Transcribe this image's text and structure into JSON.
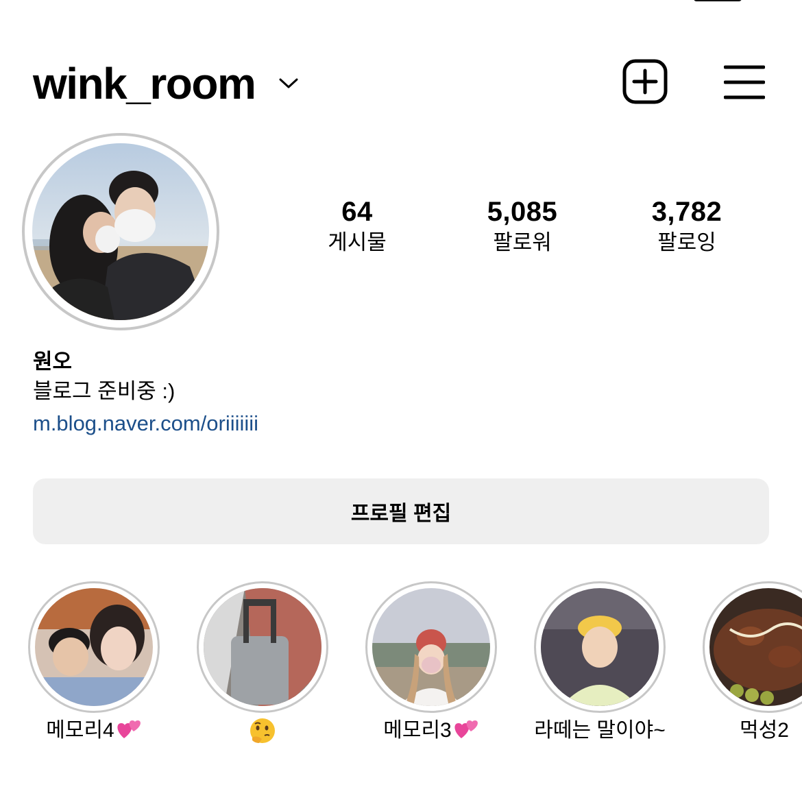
{
  "header": {
    "username": "wink_room",
    "add_icon": "plus-square-icon",
    "menu_icon": "hamburger-menu-icon"
  },
  "stats": [
    {
      "count": "64",
      "label": "게시물"
    },
    {
      "count": "5,085",
      "label": "팔로워"
    },
    {
      "count": "3,782",
      "label": "팔로잉"
    }
  ],
  "bio": {
    "name": "원오",
    "text": "블로그 준비중 :)",
    "link": "m.blog.naver.com/oriiiiiii"
  },
  "edit_profile_label": "프로필 편집",
  "highlights": [
    {
      "label": "메모리4",
      "emoji": "two-hearts"
    },
    {
      "label": "",
      "emoji": "thinking-face"
    },
    {
      "label": "메모리3",
      "emoji": "two-hearts"
    },
    {
      "label": "라떼는 말이야~",
      "emoji": ""
    },
    {
      "label": "먹성2",
      "emoji": ""
    }
  ],
  "colors": {
    "link": "#1c4f8a",
    "button_bg": "#efefef",
    "ring": "#c7c7c7",
    "heart": "#e8459a"
  }
}
